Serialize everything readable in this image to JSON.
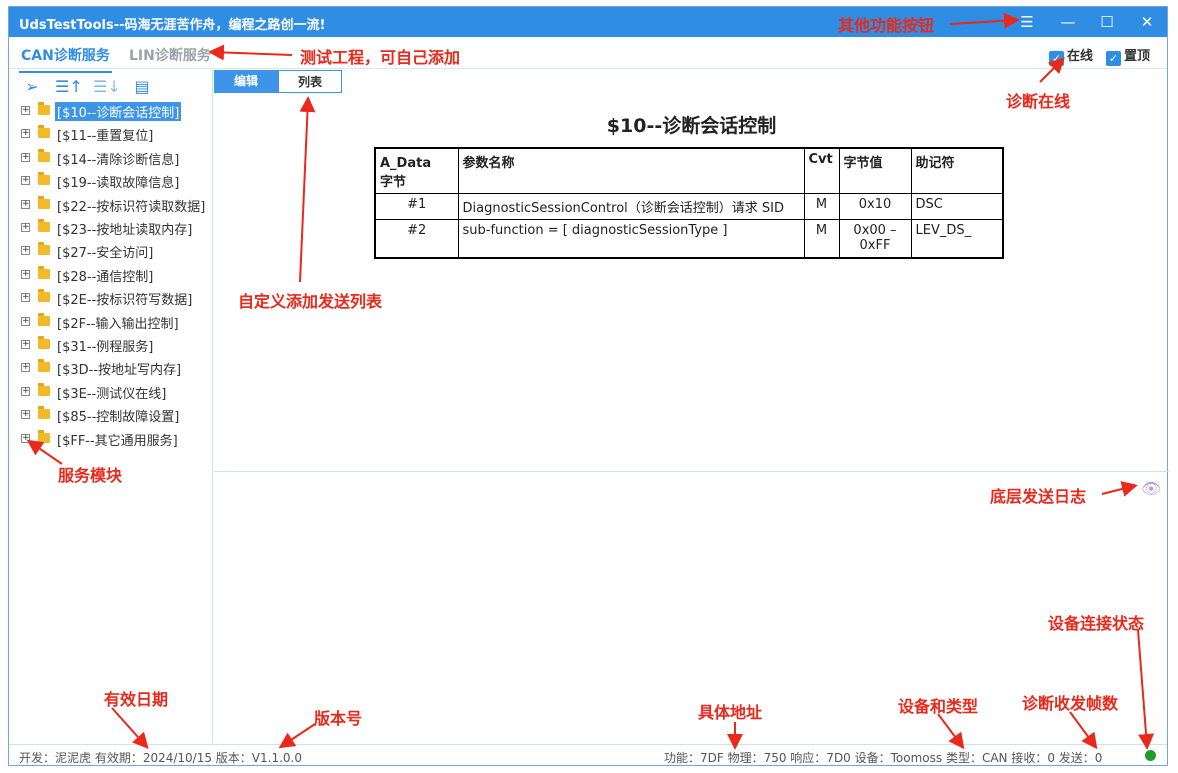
{
  "window": {
    "title": "UdsTestTools--码海无涯苦作舟，编程之路创一流!"
  },
  "tabs": [
    {
      "label": "CAN诊断服务",
      "active": true
    },
    {
      "label": "LIN诊断服务",
      "active": false
    }
  ],
  "options": {
    "online_label": "在线",
    "online_checked": true,
    "pin_top_label": "置顶",
    "pin_top_checked": true
  },
  "toolbar": {
    "icons": [
      "send-icon",
      "sort-ascending-icon",
      "sort-descending-icon",
      "document-settings-icon"
    ]
  },
  "tree": {
    "items": [
      "[$10--诊断会话控制]",
      "[$11--重置复位]",
      "[$14--清除诊断信息]",
      "[$19--读取故障信息]",
      "[$22--按标识符读取数据]",
      "[$23--按地址读取内存]",
      "[$27--安全访问]",
      "[$28--通信控制]",
      "[$2E--按标识符写数据]",
      "[$2F--输入输出控制]",
      "[$31--例程服务]",
      "[$3D--按地址写内存]",
      "[$3E--测试仪在线]",
      "[$85--控制故障设置]",
      "[$FF--其它通用服务]"
    ],
    "selected_index": 0
  },
  "subtabs": [
    {
      "label": "编辑",
      "active": true
    },
    {
      "label": "列表",
      "active": false
    }
  ],
  "document": {
    "title": "$10--诊断会话控制",
    "table": {
      "headers": [
        "A_Data　字节",
        "参数名称",
        "Cvt",
        "字节值",
        "助记符"
      ],
      "rows": [
        [
          "#1",
          "DiagnosticSessionControl（诊断会话控制）请求 SID",
          "M",
          "0x10",
          "DSC"
        ],
        [
          "#2",
          "sub-function = [ diagnosticSessionType ]",
          "M",
          "0x00 – 0xFF",
          "LEV_DS_"
        ]
      ]
    }
  },
  "status": {
    "left": "开发：泥泥虎   有效期：2024/10/15   版本：V1.1.0.0",
    "right": "功能：7DF   物理：750   响应：7D0   设备：Toomoss   类型：CAN   接收：0   发送：0",
    "connection_color": "#1e9b2c"
  },
  "annotations": {
    "other_buttons": "其他功能按钮",
    "test_project": "测试工程，可自己添加",
    "diag_online": "诊断在线",
    "custom_list": "自定义添加发送列表",
    "service_module": "服务模块",
    "log": "底层发送日志",
    "device_status": "设备连接状态",
    "valid_date": "有效日期",
    "version": "版本号",
    "address": "具体地址",
    "device_type": "设备和类型",
    "frame_count": "诊断收发帧数"
  },
  "colors": {
    "accent": "#2f8de4",
    "annotation": "#e8291c",
    "selected": "#3e95e8"
  }
}
